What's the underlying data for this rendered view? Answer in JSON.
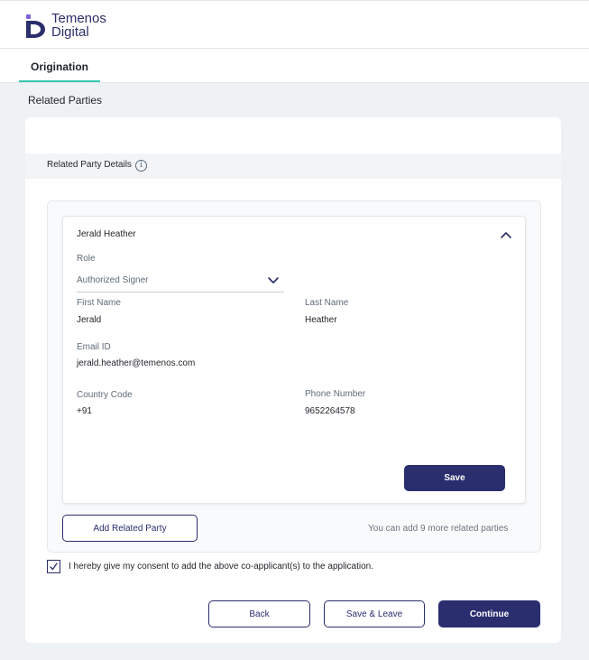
{
  "brand": {
    "line1": "Temenos",
    "line2": "Digital",
    "color": "#2b2f6b"
  },
  "tabs": [
    {
      "label": "Origination",
      "active": true
    }
  ],
  "page": {
    "section_title": "Related Parties"
  },
  "related_party_details": {
    "label": "Related Party Details",
    "info_icon": "i"
  },
  "party": {
    "name": "Jerald Heather",
    "role_label": "Role",
    "role_value": "Authorized Signer",
    "first_name_label": "First Name",
    "first_name_value": "Jerald",
    "last_name_label": "Last Name",
    "last_name_value": "Heather",
    "email_label": "Email ID",
    "email_value": "jerald.heather@temenos.com",
    "country_code_label": "Country Code",
    "country_code_value": "+91",
    "phone_label": "Phone Number",
    "phone_value": "9652264578",
    "save_label": "Save"
  },
  "add_party": {
    "button_label": "Add Related Party",
    "note": "You can add 9 more related parties"
  },
  "consent": {
    "checked": true,
    "text": "I hereby give my consent to add the above co-applicant(s) to the application."
  },
  "footer": {
    "back_label": "Back",
    "save_leave_label": "Save & Leave",
    "continue_label": "Continue"
  },
  "colors": {
    "primary": "#2a2d6e",
    "tab_accent": "#39c5b0",
    "background": "#eef2f5"
  }
}
